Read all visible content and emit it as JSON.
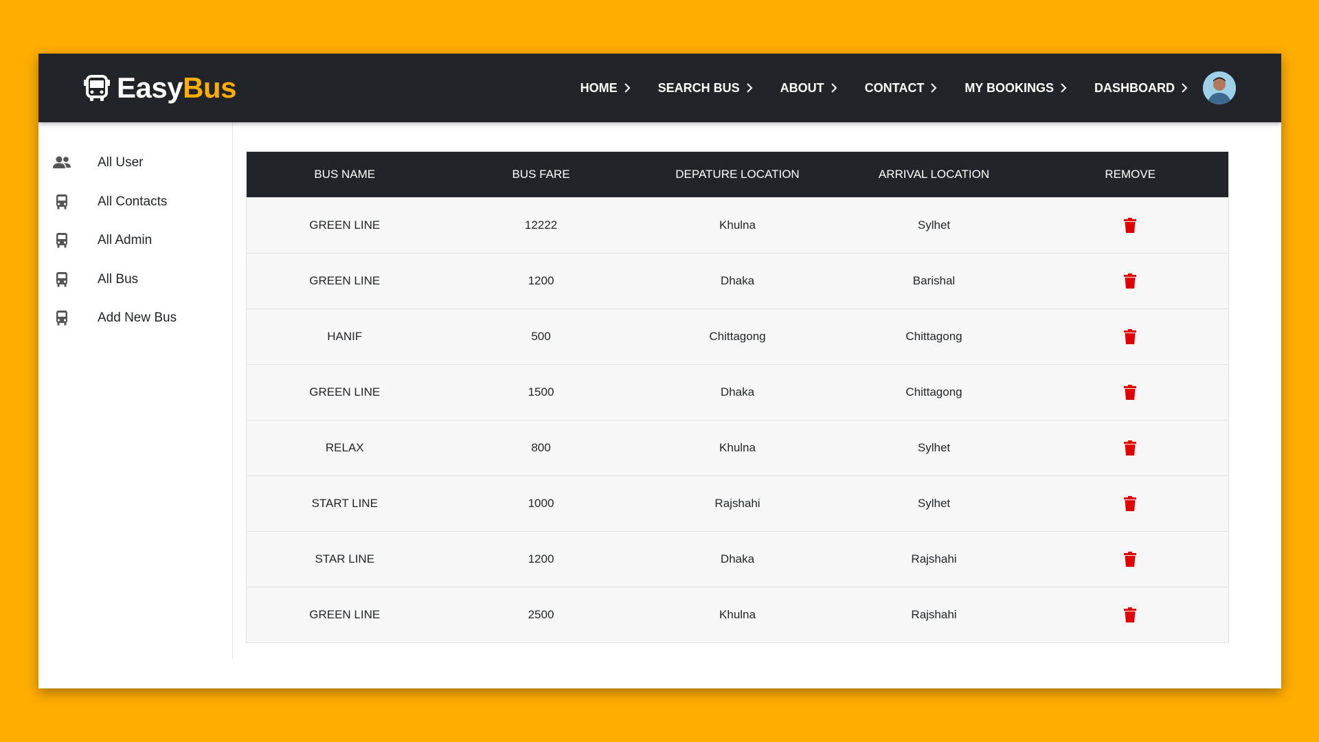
{
  "brand": {
    "name_part1": "Easy",
    "name_part2": "Bus",
    "accent_color": "#ffad00",
    "icon": "bus-icon"
  },
  "nav": {
    "items": [
      {
        "label": "HOME"
      },
      {
        "label": "SEARCH BUS"
      },
      {
        "label": "ABOUT"
      },
      {
        "label": "CONTACT"
      },
      {
        "label": "MY BOOKINGS"
      },
      {
        "label": "DASHBOARD"
      }
    ],
    "avatar_icon": "user-avatar"
  },
  "sidebar": {
    "items": [
      {
        "label": "All User",
        "icon": "users-icon"
      },
      {
        "label": "All Contacts",
        "icon": "bus-icon"
      },
      {
        "label": "All Admin",
        "icon": "bus-icon"
      },
      {
        "label": "All Bus",
        "icon": "bus-icon"
      },
      {
        "label": "Add New Bus",
        "icon": "bus-icon"
      }
    ]
  },
  "table": {
    "headers": [
      "BUS NAME",
      "BUS FARE",
      "DEPATURE LOCATION",
      "ARRIVAL LOCATION",
      "REMOVE"
    ],
    "rows": [
      [
        "GREEN LINE",
        "12222",
        "Khulna",
        "Sylhet"
      ],
      [
        "GREEN LINE",
        "1200",
        "Dhaka",
        "Barishal"
      ],
      [
        "HANIF",
        "500",
        "Chittagong",
        "Chittagong"
      ],
      [
        "GREEN LINE",
        "1500",
        "Dhaka",
        "Chittagong"
      ],
      [
        "RELAX",
        "800",
        "Khulna",
        "Sylhet"
      ],
      [
        "START LINE",
        "1000",
        "Rajshahi",
        "Sylhet"
      ],
      [
        "STAR LINE",
        "1200",
        "Dhaka",
        "Rajshahi"
      ],
      [
        "GREEN LINE",
        "2500",
        "Khulna",
        "Rajshahi"
      ]
    ],
    "remove_icon": "trash-icon",
    "remove_color": "#e00000"
  }
}
